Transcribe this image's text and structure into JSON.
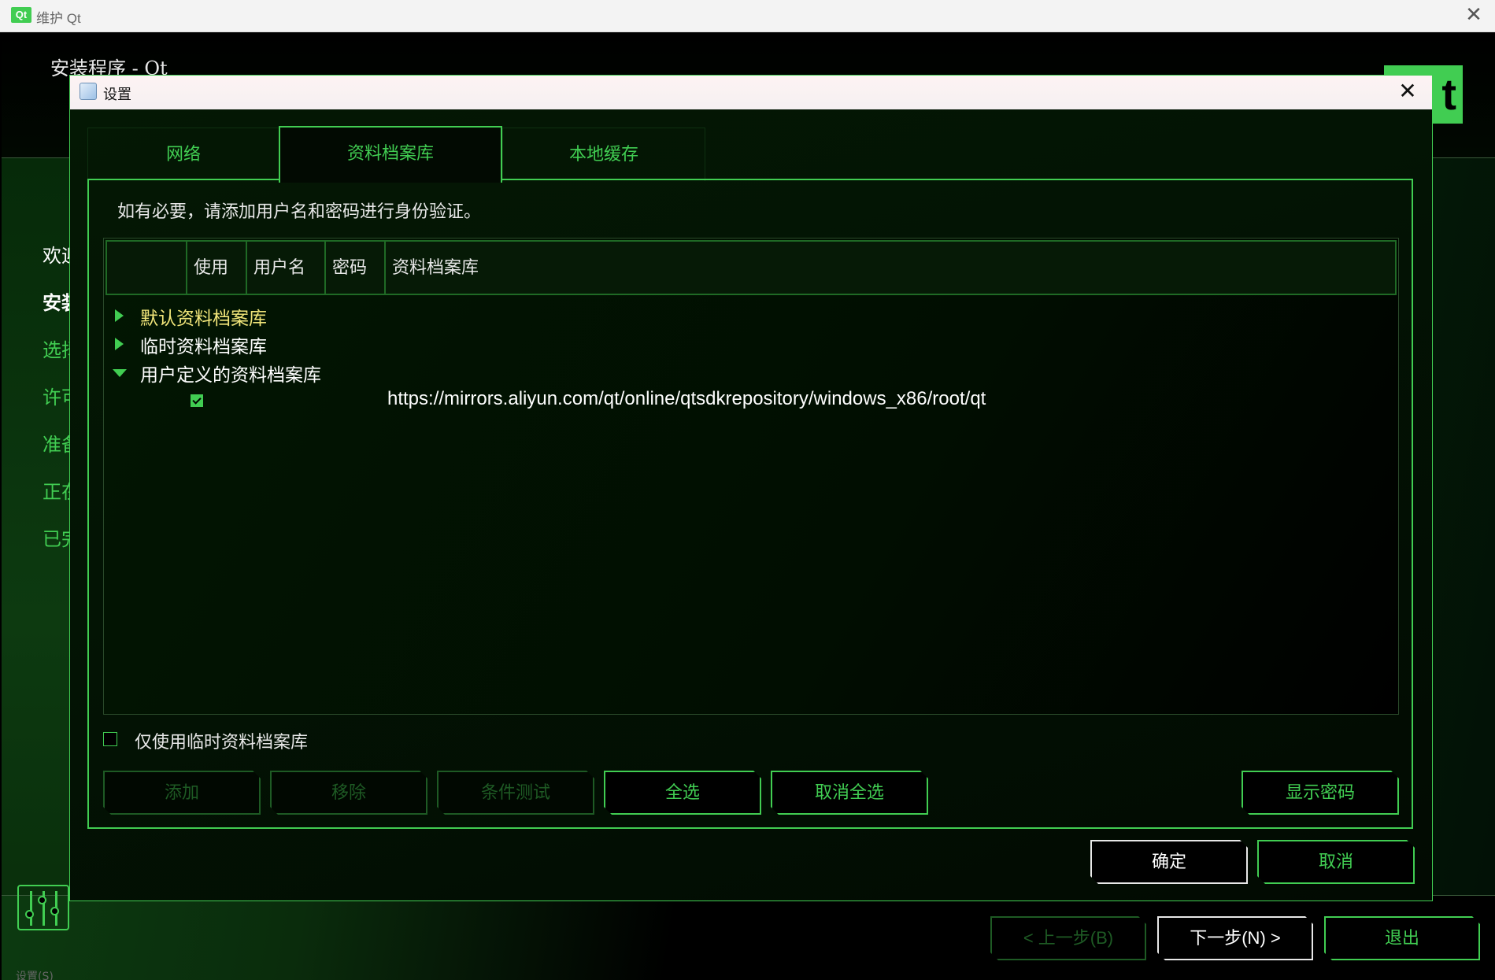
{
  "window": {
    "title": "维护 Qt",
    "logo_text": "Qt",
    "close_glyph": "✕"
  },
  "installer": {
    "title": "安装程序 - Qt",
    "logo_glyph": "t"
  },
  "sidebar": {
    "items": [
      {
        "label": "欢迎"
      },
      {
        "label": "安装"
      },
      {
        "label": "选择"
      },
      {
        "label": "许可"
      },
      {
        "label": "准备"
      },
      {
        "label": "正在"
      },
      {
        "label": "已完"
      }
    ]
  },
  "bottom": {
    "settings_label": "设置(S)",
    "back_label": "< 上一步(B)",
    "next_label": "下一步(N) >",
    "quit_label": "退出"
  },
  "dialog": {
    "title": "设置",
    "close_glyph": "✕",
    "tabs": [
      {
        "label": "网络"
      },
      {
        "label": "资料档案库"
      },
      {
        "label": "本地缓存"
      }
    ],
    "hint": "如有必要，请添加用户名和密码进行身份验证。",
    "columns": [
      "",
      "使用",
      "用户名",
      "密码",
      "资料档案库"
    ],
    "tree": [
      {
        "label": "默认资料档案库",
        "expanded": false
      },
      {
        "label": "临时资料档案库",
        "expanded": false
      },
      {
        "label": "用户定义的资料档案库",
        "expanded": true,
        "children": [
          {
            "use": true,
            "username": "",
            "password": "",
            "url": "https://mirrors.aliyun.com/qt/online/qtsdkrepository/windows_x86/root/qt"
          }
        ]
      }
    ],
    "only_temp_label": "仅使用临时资料档案库",
    "only_temp_checked": false,
    "buttons": {
      "add": "添加",
      "remove": "移除",
      "test": "条件测试",
      "select_all": "全选",
      "deselect_all": "取消全选",
      "show_password": "显示密码",
      "ok": "确定",
      "cancel": "取消"
    }
  },
  "colors": {
    "accent": "#41cd52",
    "highlight_text": "#f2e67a",
    "background": "#000000"
  }
}
